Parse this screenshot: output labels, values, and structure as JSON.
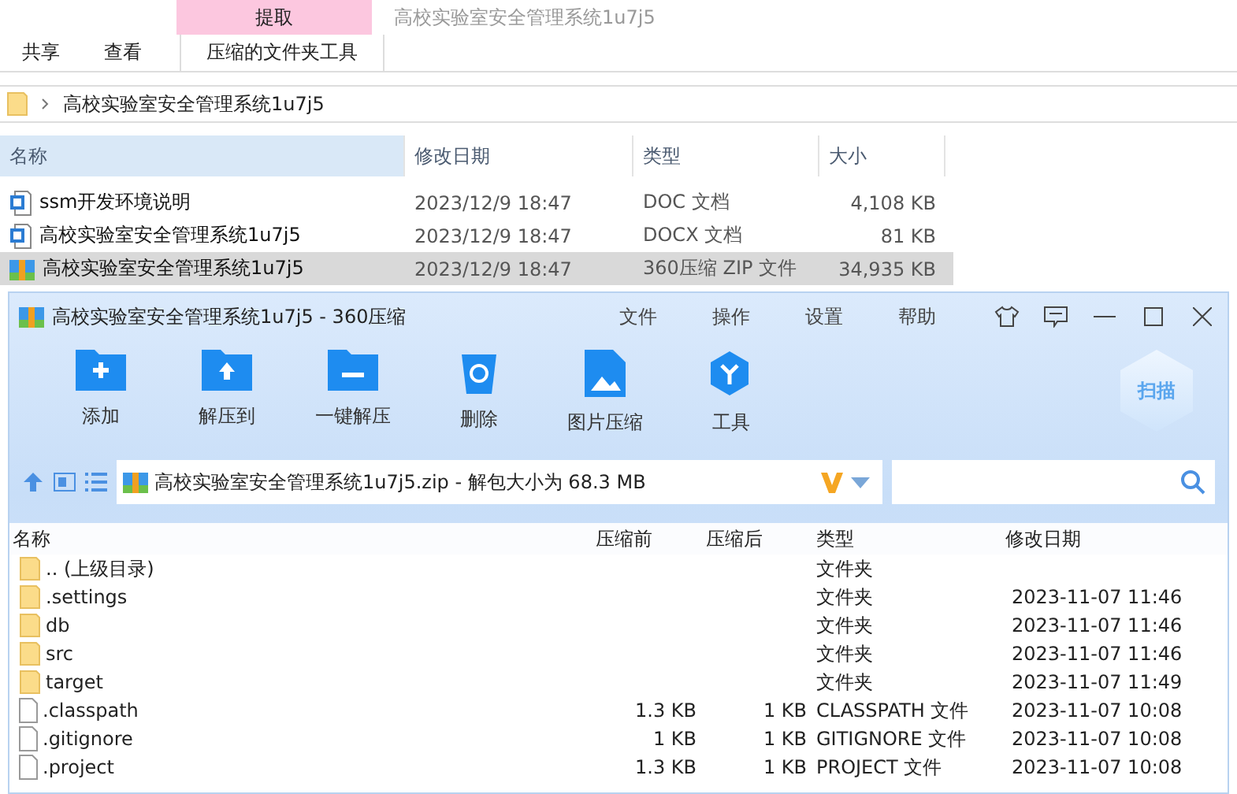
{
  "explorer": {
    "context_tab": "提取",
    "window_title": "高校实验室安全管理系统1u7j5",
    "tabs": [
      {
        "label": "共享",
        "selected": false
      },
      {
        "label": "查看",
        "selected": false
      },
      {
        "label": "压缩的文件夹工具",
        "selected": true
      }
    ],
    "breadcrumb": "高校实验室安全管理系统1u7j5",
    "columns": [
      "名称",
      "修改日期",
      "类型",
      "大小"
    ],
    "files": [
      {
        "name": "ssm开发环境说明",
        "date": "2023/12/9 18:47",
        "type": "DOC 文档",
        "size": "4,108 KB",
        "kind": "doc",
        "selected": false
      },
      {
        "name": "高校实验室安全管理系统1u7j5",
        "date": "2023/12/9 18:47",
        "type": "DOCX 文档",
        "size": "81 KB",
        "kind": "doc",
        "selected": false
      },
      {
        "name": "高校实验室安全管理系统1u7j5",
        "date": "2023/12/9 18:47",
        "type": "360压缩 ZIP 文件",
        "size": "34,935 KB",
        "kind": "zip",
        "selected": true
      }
    ]
  },
  "archiver": {
    "title": "高校实验室安全管理系统1u7j5 - 360压缩",
    "menu": [
      "文件",
      "操作",
      "设置",
      "帮助"
    ],
    "tools": [
      {
        "label": "添加",
        "kind": "add"
      },
      {
        "label": "解压到",
        "kind": "extract"
      },
      {
        "label": "一键解压",
        "kind": "oneclick"
      },
      {
        "label": "删除",
        "kind": "delete"
      },
      {
        "label": "图片压缩",
        "kind": "image"
      },
      {
        "label": "工具",
        "kind": "tools"
      }
    ],
    "scan_label": "扫描",
    "path": "高校实验室安全管理系统1u7j5.zip - 解包大小为 68.3 MB",
    "columns": [
      "名称",
      "压缩前",
      "压缩后",
      "类型",
      "修改日期"
    ],
    "entries": [
      {
        "name": ".. (上级目录)",
        "kind": "folder",
        "type": "文件夹"
      },
      {
        "name": ".settings",
        "kind": "folder",
        "type": "文件夹",
        "date": "2023-11-07 11:46"
      },
      {
        "name": "db",
        "kind": "folder",
        "type": "文件夹",
        "date": "2023-11-07 11:46"
      },
      {
        "name": "src",
        "kind": "folder",
        "type": "文件夹",
        "date": "2023-11-07 11:46"
      },
      {
        "name": "target",
        "kind": "folder",
        "type": "文件夹",
        "date": "2023-11-07 11:49"
      },
      {
        "name": ".classpath",
        "kind": "file",
        "before": "1.3 KB",
        "after": "1 KB",
        "type": "CLASSPATH 文件",
        "date": "2023-11-07 10:08"
      },
      {
        "name": ".gitignore",
        "kind": "file",
        "before": "1 KB",
        "after": "1 KB",
        "type": "GITIGNORE 文件",
        "date": "2023-11-07 10:08"
      },
      {
        "name": ".project",
        "kind": "file",
        "before": "1.3 KB",
        "after": "1 KB",
        "type": "PROJECT 文件",
        "date": "2023-11-07 10:08"
      }
    ]
  }
}
